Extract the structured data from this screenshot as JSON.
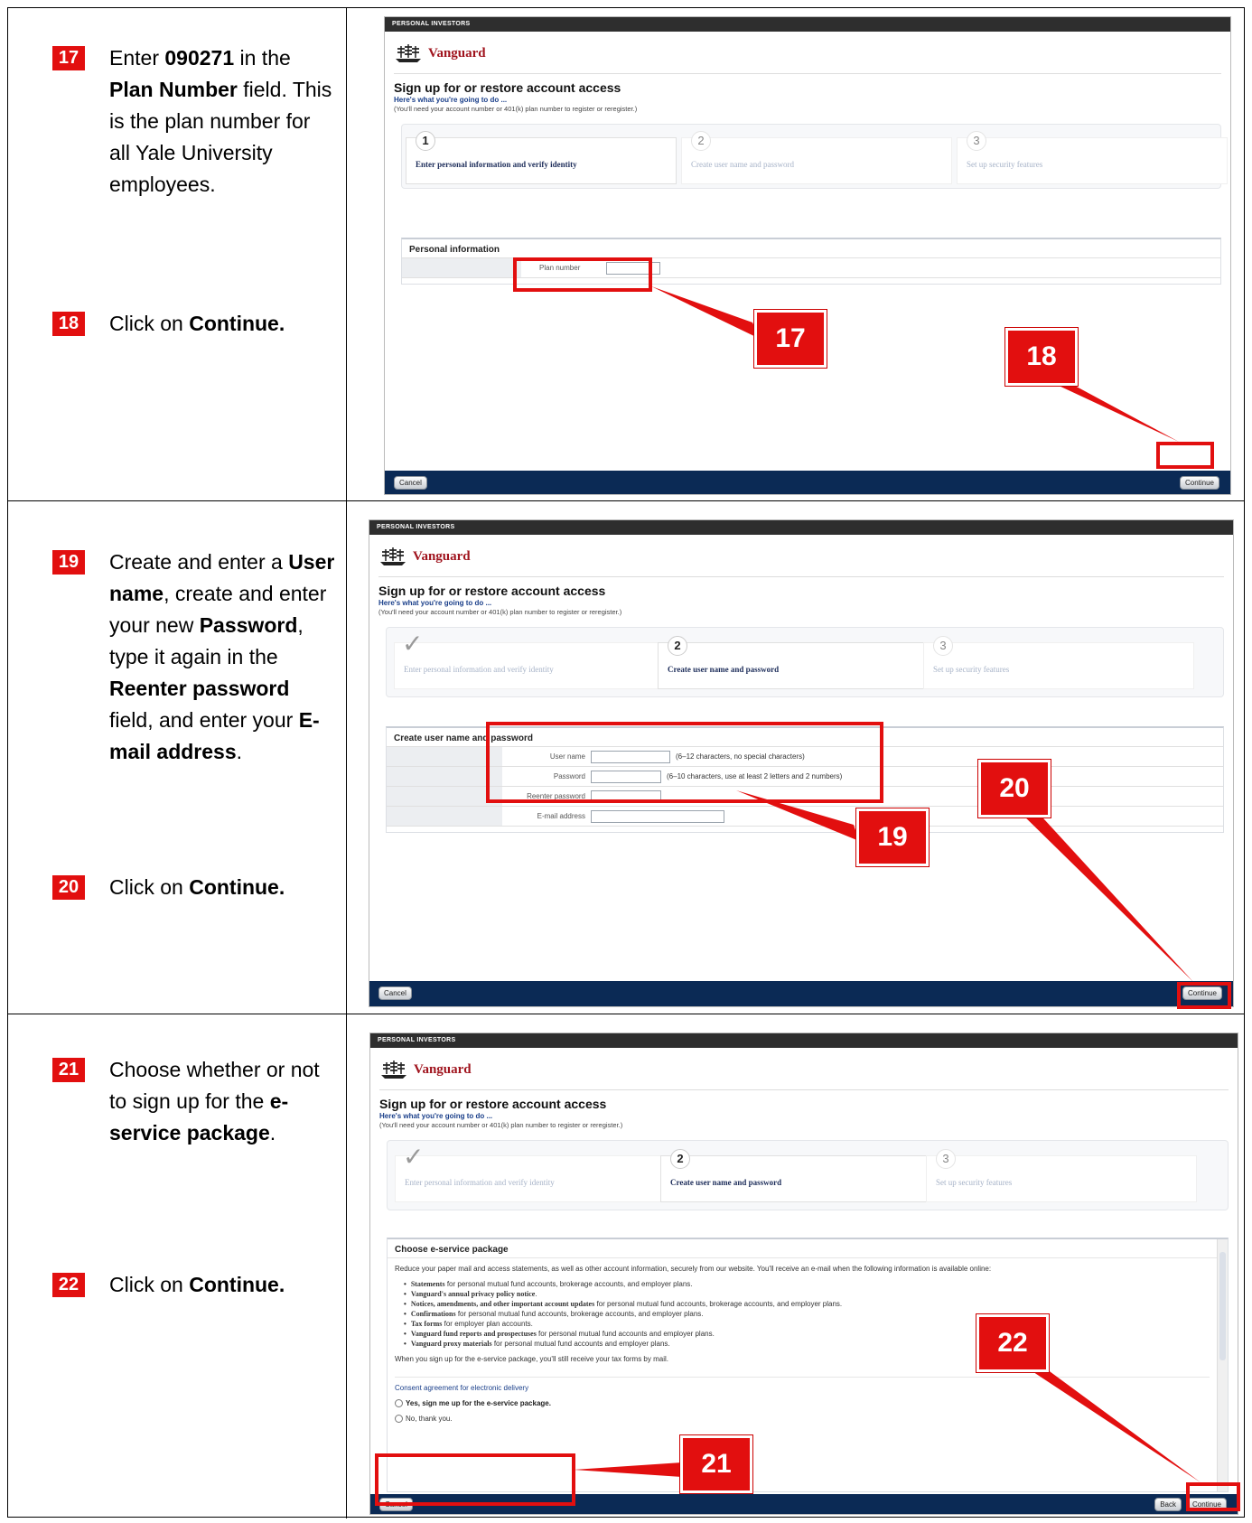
{
  "steps": [
    {
      "num": "17",
      "pre": "Enter ",
      "b1": "090271",
      "mid1": " in the ",
      "b2": "Plan Number",
      "post": " field. This is the plan number for all Yale University employees."
    },
    {
      "num": "18",
      "pre": "Click on ",
      "b1": "Continue.",
      "post": ""
    },
    {
      "num": "19",
      "pre": "Create and enter a ",
      "b1": "User name",
      "mid1": ", create and enter your new ",
      "b2": "Password",
      "mid2": ", type it again in the ",
      "b3": "Reenter password",
      "mid3": " field, and enter your ",
      "b4": "E-mail address",
      "post": "."
    },
    {
      "num": "20",
      "pre": "Click on ",
      "b1": "Continue.",
      "post": ""
    },
    {
      "num": "21",
      "pre": "Choose whether or not to sign up for the ",
      "b1": "e-service package",
      "post": "."
    },
    {
      "num": "22",
      "pre": "Click on ",
      "b1": "Continue.",
      "post": ""
    }
  ],
  "site": {
    "topbar": "PERSONAL INVESTORS",
    "brand": "Vanguard",
    "title": "Sign up for or restore account access",
    "link": "Here's what you're going to do ...",
    "note": "(You'll need your account number or 401(k) plan number to register or reregister.)",
    "step1": "Enter personal information and verify identity",
    "step2": "Create user name and password",
    "step3": "Set up security features",
    "n1": "1",
    "n2": "2",
    "n3": "3",
    "checkmark": "✓",
    "cancel": "Cancel",
    "continue": "Continue",
    "back": "Back"
  },
  "panel1": {
    "section": "Personal information",
    "plan_label": "Plan number",
    "plan_value": ""
  },
  "panel2": {
    "section": "Create user name and password",
    "fields": [
      {
        "label": "User name",
        "hint": "(6–12 characters, no special characters)"
      },
      {
        "label": "Password",
        "hint": "(6–10 characters, use at least 2 letters and 2 numbers)"
      },
      {
        "label": "Reenter password",
        "hint": ""
      },
      {
        "label": "E-mail address",
        "hint": ""
      }
    ]
  },
  "panel3": {
    "section": "Choose e-service package",
    "intro": "Reduce your paper mail and access statements, as well as other account information, securely from our website. You'll receive an e-mail when the following information is available online:",
    "items": [
      {
        "b": "Statements",
        "t": " for personal mutual fund accounts, brokerage accounts, and employer plans."
      },
      {
        "b": "Vanguard's annual privacy policy notice",
        "t": "."
      },
      {
        "b": "Notices, amendments, and other important account updates",
        "t": " for personal mutual fund accounts, brokerage accounts, and employer plans."
      },
      {
        "b": "Confirmations",
        "t": " for personal mutual fund accounts, brokerage accounts, and employer plans."
      },
      {
        "b": "Tax forms",
        "t": " for employer plan accounts."
      },
      {
        "b": "Vanguard fund reports and prospectuses",
        "t": " for personal mutual fund accounts and employer plans."
      },
      {
        "b": "Vanguard proxy materials",
        "t": " for personal mutual fund accounts and employer plans."
      }
    ],
    "outro": "When you sign up for the e-service package, you'll still receive your tax forms by mail.",
    "consent": "Consent agreement for electronic delivery",
    "yes": "Yes, sign me up for the e-service package.",
    "no": "No, thank you."
  },
  "accent": "#e20f0f",
  "footer_color": "#0b2a55"
}
